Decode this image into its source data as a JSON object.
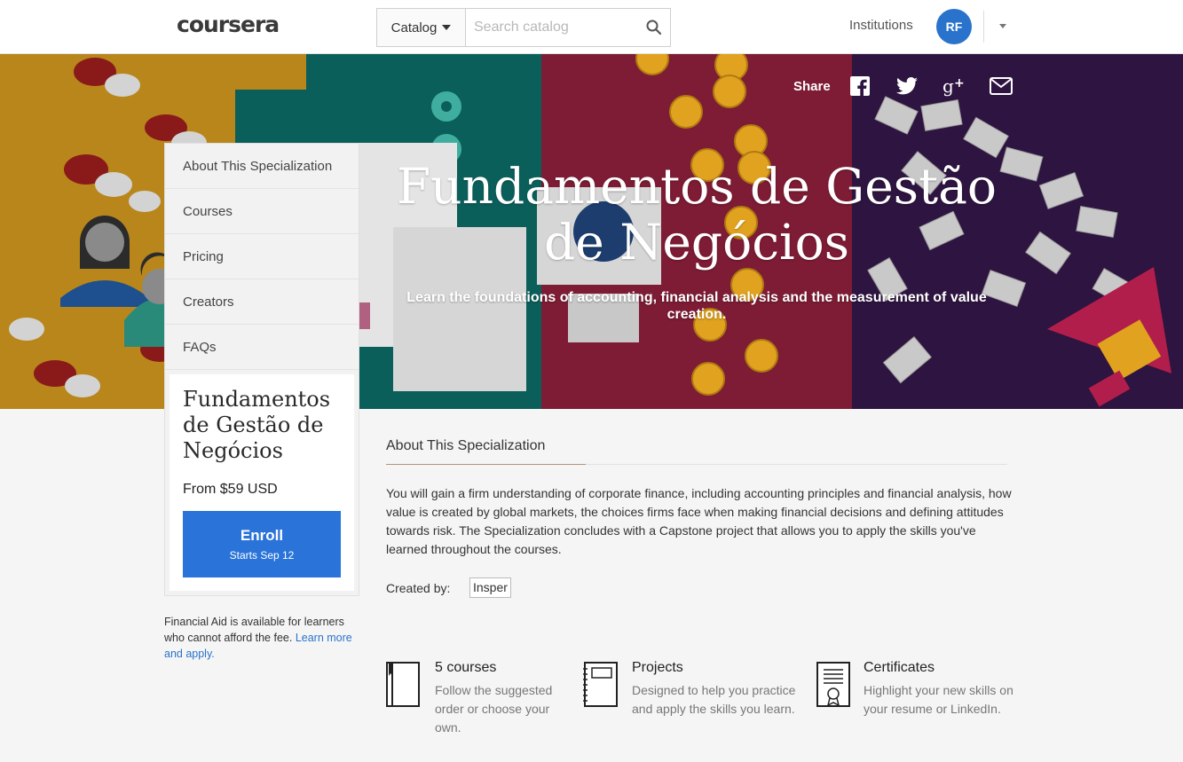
{
  "nav": {
    "logo": "coursera",
    "catalog_label": "Catalog",
    "search_placeholder": "Search catalog",
    "institutions": "Institutions",
    "avatar_initials": "RF"
  },
  "hero": {
    "share_label": "Share",
    "title": "Fundamentos de Gestão de Negócios",
    "tagline": "Learn the foundations of accounting, financial analysis and the measurement of value creation.",
    "share_icons": [
      "facebook-icon",
      "twitter-icon",
      "google-plus-icon",
      "email-icon"
    ]
  },
  "sidenav": {
    "items": [
      {
        "label": "About This Specialization"
      },
      {
        "label": "Courses"
      },
      {
        "label": "Pricing"
      },
      {
        "label": "Creators"
      },
      {
        "label": "FAQs"
      }
    ]
  },
  "enroll_card": {
    "title": "Fundamentos de Gestão de Negócios",
    "price": "From $59 USD",
    "button_label": "Enroll",
    "button_sub": "Starts Sep 12"
  },
  "financial_aid": {
    "text": "Financial Aid is available for learners who cannot afford the fee.",
    "link": "Learn more and apply."
  },
  "about": {
    "heading": "About This Specialization",
    "body": "You will gain a firm understanding of corporate finance, including accounting principles and financial analysis, how value is created by global markets, the choices firms face when making financial decisions and defining attitudes towards risk. The Specialization concludes with a Capstone project that allows you to apply the skills you've learned throughout the courses.",
    "created_by_label": "Created by:",
    "creator": "Insper"
  },
  "features": [
    {
      "title": "5 courses",
      "desc": "Follow the suggested order or choose your own.",
      "icon": "book-icon"
    },
    {
      "title": "Projects",
      "desc": "Designed to help you practice and apply the skills you learn.",
      "icon": "notebook-icon"
    },
    {
      "title": "Certificates",
      "desc": "Highlight your new skills on your resume or LinkedIn.",
      "icon": "certificate-icon"
    }
  ],
  "colors": {
    "brand_blue": "#2a73d9",
    "hero_mustard": "#b8861b",
    "hero_teal": "#0b5f5b",
    "hero_crimson": "#7d1c34",
    "hero_purple": "#2e1440"
  }
}
